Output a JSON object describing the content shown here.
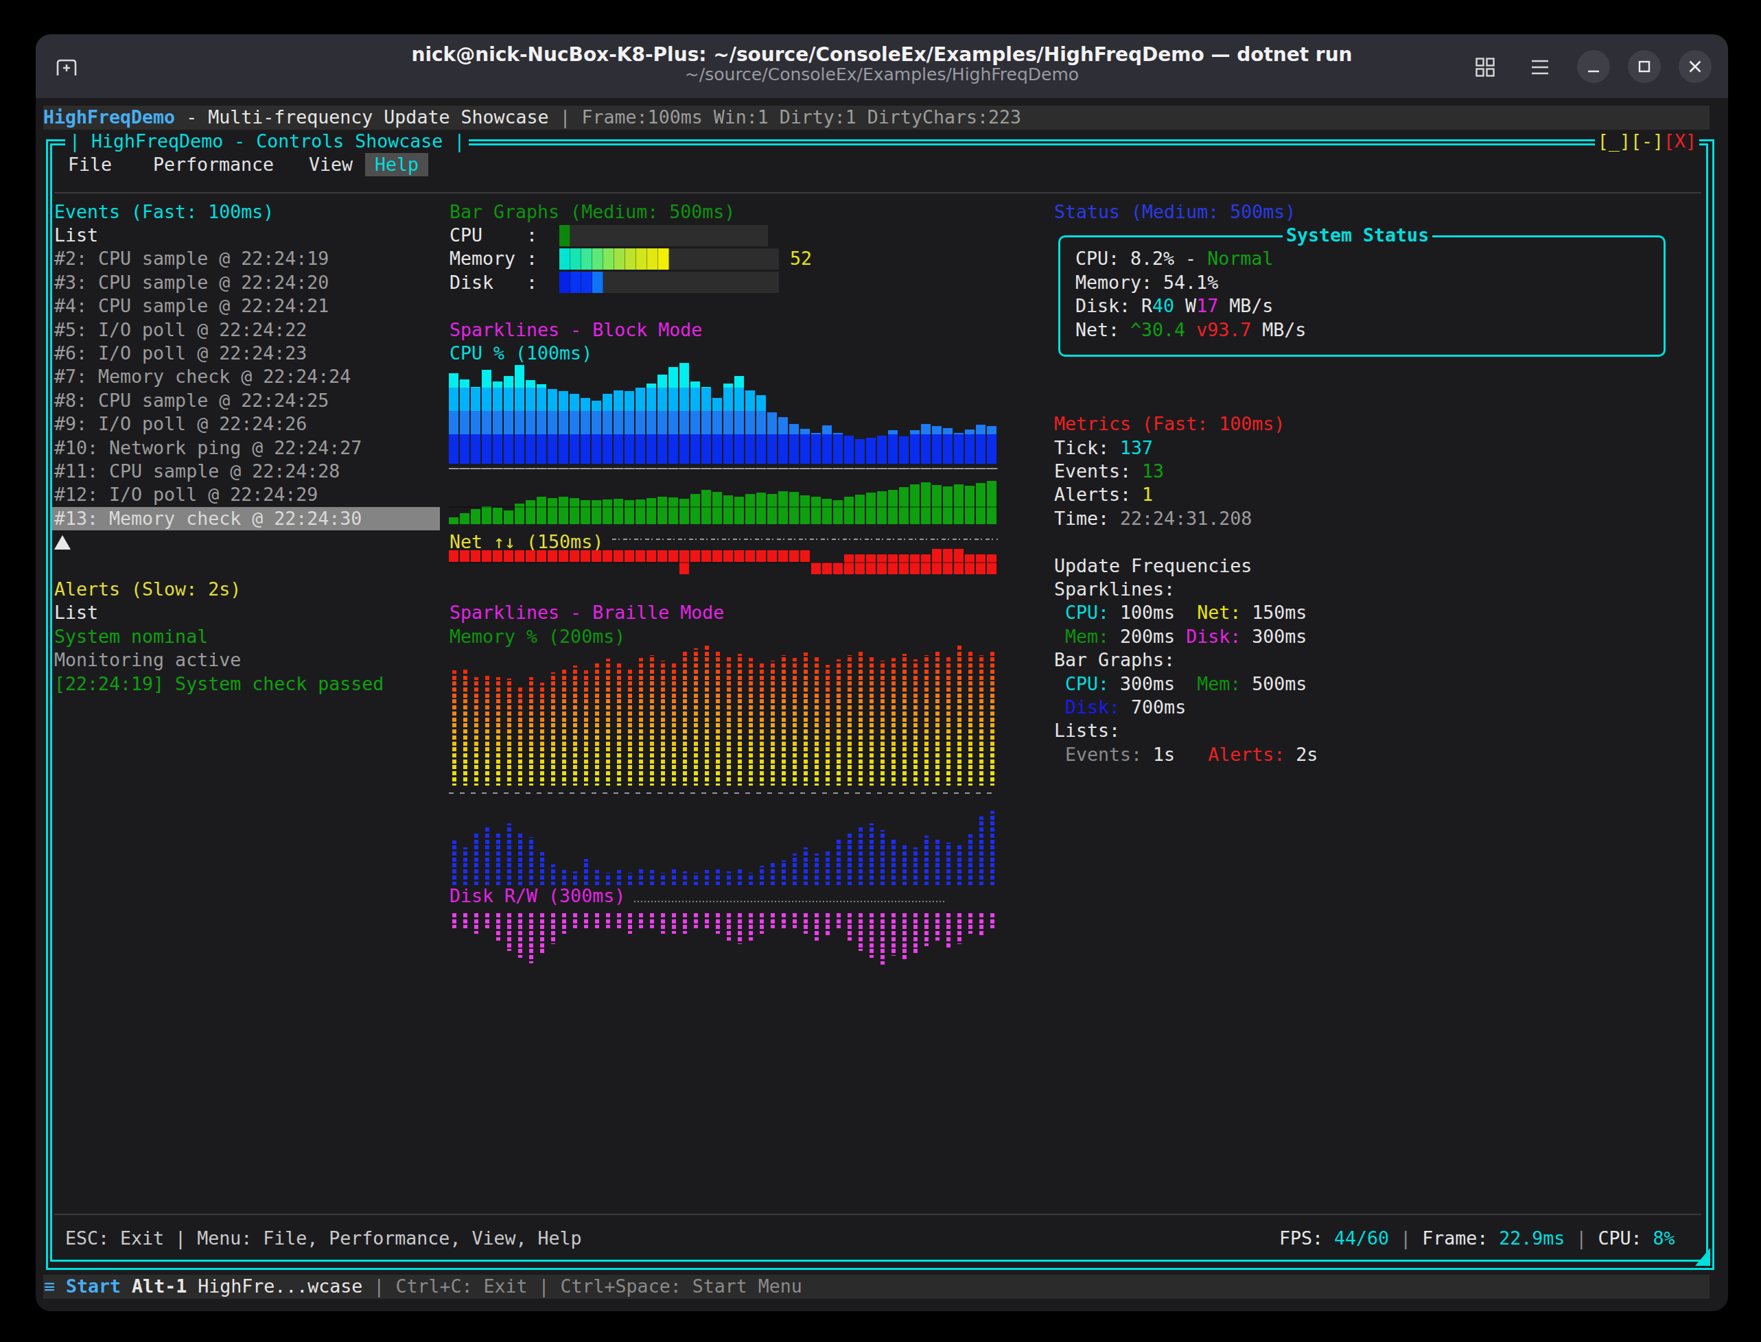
{
  "titlebar": {
    "title": "nick@nick-NucBox-K8-Plus: ~/source/ConsoleEx/Examples/HighFreqDemo — dotnet run",
    "subtitle": "~/source/ConsoleEx/Examples/HighFreqDemo",
    "icons": [
      "new-tab",
      "workspaces-grid",
      "menu",
      "minimize",
      "maximize",
      "close"
    ]
  },
  "app_status": {
    "segments": [
      {
        "t": "HighFreqDemo",
        "c": "skyblue",
        "b": true
      },
      {
        "t": " - Multi-frequency Update Showcase ",
        "c": "white"
      },
      {
        "t": "| Frame:100ms Win:1 Dirty:1 DirtyChars:223",
        "c": "grey"
      }
    ]
  },
  "tui_window": {
    "title": "| HighFreqDemo - Controls Showcase |",
    "buttons": [
      {
        "t": "[_]",
        "c": "yellow"
      },
      {
        "t": "[-]",
        "c": "yellow"
      },
      {
        "t": "[X]",
        "c": "red"
      }
    ]
  },
  "menu": {
    "items": [
      {
        "label": "File",
        "active": false
      },
      {
        "label": "Performance",
        "active": false
      },
      {
        "label": "View",
        "active": false
      },
      {
        "label": "Help",
        "active": true
      }
    ]
  },
  "events_panel": {
    "title": "Events (Fast: 100ms)",
    "list_label": "List",
    "items": [
      "#2: CPU sample @ 22:24:19",
      "#3: CPU sample @ 22:24:20",
      "#4: CPU sample @ 22:24:21",
      "#5: I/O poll @ 22:24:22",
      "#6: I/O poll @ 22:24:23",
      "#7: Memory check @ 22:24:24",
      "#8: CPU sample @ 22:24:25",
      "#9: I/O poll @ 22:24:26",
      "#10: Network ping @ 22:24:27",
      "#11: CPU sample @ 22:24:28",
      "#12: I/O poll @ 22:24:29",
      "#13: Memory check @ 22:24:30"
    ],
    "selected_index": 11,
    "scroll_indicator": "▲"
  },
  "alerts_panel": {
    "title": "Alerts (Slow: 2s)",
    "list_label": "List",
    "items": [
      {
        "t": "System nominal",
        "c": "green"
      },
      {
        "t": "Monitoring active",
        "c": "grey"
      },
      {
        "t": "[22:24:19] System check passed",
        "c": "green"
      }
    ]
  },
  "bar_graphs": {
    "title": "Bar Graphs (Medium: 500ms)",
    "cpu_label": "CPU    :",
    "memory_label": "Memory :",
    "disk_label": "Disk   :",
    "memory_value": "52"
  },
  "sparklines_block": {
    "title": "Sparklines - Block Mode",
    "cpu_label": "CPU % (100ms)",
    "net_label": "Net ↑↓ (150ms)"
  },
  "sparklines_braille": {
    "title": "Sparklines - Braille Mode",
    "memory_label": "Memory % (200ms)",
    "disk_label": "Disk R/W (300ms)"
  },
  "status_panel": {
    "title": "Status (Medium: 500ms)",
    "box_title": "System Status",
    "cpu": {
      "segments": [
        {
          "t": "CPU: 8.2% - ",
          "c": "white"
        },
        {
          "t": "Normal",
          "c": "green"
        }
      ]
    },
    "memory": {
      "segments": [
        {
          "t": "Memory: 54.1%",
          "c": "white"
        }
      ]
    },
    "disk": {
      "segments": [
        {
          "t": "Disk: R",
          "c": "white"
        },
        {
          "t": "40",
          "c": "cyan"
        },
        {
          "t": " W",
          "c": "white"
        },
        {
          "t": "17",
          "c": "magenta"
        },
        {
          "t": " MB/s",
          "c": "white"
        }
      ]
    },
    "net": {
      "segments": [
        {
          "t": "Net: ",
          "c": "white"
        },
        {
          "t": "^30.4",
          "c": "green"
        },
        {
          "t": " ",
          "c": "white"
        },
        {
          "t": "v93.7",
          "c": "red"
        },
        {
          "t": " MB/s",
          "c": "white"
        }
      ]
    }
  },
  "metrics_panel": {
    "title": "Metrics (Fast: 100ms)",
    "tick": {
      "segments": [
        {
          "t": "Tick: ",
          "c": "white"
        },
        {
          "t": "137",
          "c": "cyan"
        }
      ]
    },
    "events": {
      "segments": [
        {
          "t": "Events: ",
          "c": "white"
        },
        {
          "t": "13",
          "c": "green"
        }
      ]
    },
    "alerts": {
      "segments": [
        {
          "t": "Alerts: ",
          "c": "white"
        },
        {
          "t": "1",
          "c": "vyellow"
        }
      ]
    },
    "time": {
      "segments": [
        {
          "t": "Time: ",
          "c": "white"
        },
        {
          "t": "22:24:31.208",
          "c": "grey"
        }
      ]
    }
  },
  "update_frequencies": {
    "heading": "Update Frequencies",
    "sparklines_heading": "Sparklines:",
    "sparklines_row1": {
      "segments": [
        {
          "t": " ",
          "c": "white"
        },
        {
          "t": "CPU:",
          "c": "cyan"
        },
        {
          "t": " 100ms  ",
          "c": "white"
        },
        {
          "t": "Net:",
          "c": "vyellow"
        },
        {
          "t": " 150ms",
          "c": "white"
        }
      ]
    },
    "sparklines_row2": {
      "segments": [
        {
          "t": " ",
          "c": "white"
        },
        {
          "t": "Mem:",
          "c": "dgreen"
        },
        {
          "t": " 200ms ",
          "c": "white"
        },
        {
          "t": "Disk:",
          "c": "magenta"
        },
        {
          "t": " 300ms",
          "c": "white"
        }
      ]
    },
    "bars_heading": "Bar Graphs:",
    "bars_row1": {
      "segments": [
        {
          "t": " ",
          "c": "white"
        },
        {
          "t": "CPU:",
          "c": "cyan"
        },
        {
          "t": " 300ms  ",
          "c": "white"
        },
        {
          "t": "Mem:",
          "c": "dgreen"
        },
        {
          "t": " 500ms",
          "c": "white"
        }
      ]
    },
    "bars_row2": {
      "segments": [
        {
          "t": " ",
          "c": "white"
        },
        {
          "t": "Disk:",
          "c": "pblue"
        },
        {
          "t": " 700ms",
          "c": "white"
        }
      ]
    },
    "lists_heading": "Lists:",
    "lists_row": {
      "segments": [
        {
          "t": " ",
          "c": "white"
        },
        {
          "t": "Events:",
          "c": "dim"
        },
        {
          "t": " 1s   ",
          "c": "white"
        },
        {
          "t": "Alerts:",
          "c": "red"
        },
        {
          "t": " 2s",
          "c": "white"
        }
      ]
    }
  },
  "status_bar": {
    "left": "ESC: Exit | Menu: File, Performance, View, Help",
    "right": {
      "segments": [
        {
          "t": "FPS: ",
          "c": "white"
        },
        {
          "t": "44/60",
          "c": "cyan"
        },
        {
          "t": " | ",
          "c": "dim"
        },
        {
          "t": "Frame: ",
          "c": "white"
        },
        {
          "t": "22.9ms",
          "c": "cyan"
        },
        {
          "t": " | ",
          "c": "dim"
        },
        {
          "t": "CPU: ",
          "c": "white"
        },
        {
          "t": "8%",
          "c": "cyan"
        }
      ]
    }
  },
  "taskbar": {
    "segments": [
      {
        "t": "≡ ",
        "c": "skyblue"
      },
      {
        "t": "Start",
        "c": "skyblue",
        "b": true
      },
      {
        "t": " ",
        "c": "white"
      },
      {
        "t": "Alt-1",
        "c": "white",
        "b": true
      },
      {
        "t": " HighFre...wcase ",
        "c": "white"
      },
      {
        "t": "| Ctrl+C: Exit | Ctrl+Space: Start Menu",
        "c": "dim"
      }
    ]
  },
  "colors": {
    "terminal_bg": "#1B1B1E",
    "titlebar_bg": "#2E2E36",
    "status_row_bg": "#2D2D2D",
    "taskbar_bg": "#2B2B2B",
    "border_cyan": "#00DEDE",
    "accent_skyblue": "#47AEF2",
    "yellow": "#E2DE38",
    "green": "#0FA00F",
    "magenta": "#E424E4",
    "red": "#F02020",
    "blue": "#2A3AE8",
    "selected_row_bg": "#848484"
  },
  "chart_data": [
    {
      "id": "bar_cpu",
      "type": "bar",
      "title": "CPU",
      "track_cells": 19,
      "cells": [
        "#0C870C"
      ]
    },
    {
      "id": "bar_memory",
      "type": "bar",
      "title": "Memory",
      "value": 52,
      "track_cells": 20,
      "cells": [
        "#00E5D2",
        "#16E5B2",
        "#3BE896",
        "#5EE878",
        "#83E858",
        "#A3E241",
        "#BEE32C",
        "#D2E61C",
        "#E2E812",
        "#F2F004"
      ]
    },
    {
      "id": "bar_disk",
      "type": "bar",
      "title": "Disk",
      "track_cells": 20,
      "cells": [
        "#0522E8",
        "#0734F2",
        "#0734F2",
        "#0F74F6"
      ]
    },
    {
      "id": "cpu_sparkline",
      "type": "area",
      "title": "CPU % (100ms)",
      "max": 147,
      "band_colors": [
        "#00EEF0",
        "#00B2F8",
        "#1E7CF2",
        "#0A2CEE"
      ],
      "band_stops": [
        147,
        111,
        77,
        43
      ],
      "values": [
        132,
        123,
        112,
        137,
        120,
        128,
        144,
        122,
        116,
        109,
        106,
        102,
        96,
        92,
        102,
        107,
        106,
        111,
        117,
        130,
        141,
        147,
        120,
        112,
        96,
        117,
        128,
        107,
        100,
        75,
        68,
        58,
        51,
        45,
        56,
        45,
        41,
        36,
        38,
        41,
        49,
        40,
        49,
        58,
        55,
        52,
        45,
        50,
        57,
        55
      ]
    },
    {
      "id": "memory_sparkline",
      "type": "area",
      "title": "Memory",
      "max": 64,
      "color": "#0EA00E",
      "values": [
        10,
        16,
        22,
        26,
        24,
        20,
        30,
        35,
        40,
        38,
        40,
        38,
        35,
        35,
        36,
        37,
        35,
        36,
        38,
        40,
        39,
        37,
        44,
        50,
        47,
        42,
        40,
        44,
        46,
        44,
        48,
        47,
        42,
        40,
        37,
        35,
        40,
        43,
        46,
        48,
        50,
        54,
        58,
        61,
        57,
        55,
        58,
        56,
        60,
        63
      ]
    },
    {
      "id": "net_sparkline",
      "type": "area",
      "title": "Net ↑↓ (150ms)",
      "color": "#F01414",
      "values": [
        [
          2,
          17
        ],
        [
          2,
          17
        ],
        [
          2,
          17
        ],
        [
          2,
          17
        ],
        [
          2,
          17
        ],
        [
          2,
          17
        ],
        [
          2,
          17
        ],
        [
          2,
          17
        ],
        [
          2,
          17
        ],
        [
          2,
          17
        ],
        [
          2,
          17
        ],
        [
          2,
          17
        ],
        [
          2,
          17
        ],
        [
          2,
          17
        ],
        [
          2,
          17
        ],
        [
          2,
          17
        ],
        [
          2,
          17
        ],
        [
          2,
          17
        ],
        [
          2,
          17
        ],
        [
          2,
          17
        ],
        [
          2,
          17
        ],
        [
          2,
          35
        ],
        [
          2,
          17
        ],
        [
          2,
          17
        ],
        [
          2,
          17
        ],
        [
          2,
          17
        ],
        [
          2,
          17
        ],
        [
          2,
          17
        ],
        [
          2,
          17
        ],
        [
          2,
          17
        ],
        [
          2,
          17
        ],
        [
          2,
          17
        ],
        [
          2,
          17
        ],
        [
          20,
          17
        ],
        [
          20,
          17
        ],
        [
          20,
          17
        ],
        [
          8,
          29
        ],
        [
          8,
          29
        ],
        [
          8,
          29
        ],
        [
          8,
          29
        ],
        [
          8,
          29
        ],
        [
          8,
          29
        ],
        [
          8,
          29
        ],
        [
          8,
          29
        ],
        [
          0,
          37
        ],
        [
          0,
          37
        ],
        [
          0,
          37
        ],
        [
          8,
          29
        ],
        [
          8,
          29
        ],
        [
          8,
          29
        ]
      ]
    },
    {
      "id": "braille_memory",
      "type": "area",
      "title": "Memory % (200ms)",
      "max": 204,
      "gradient": [
        "#F5270A",
        "#F5480C",
        "#F57D12",
        "#F2A90C",
        "#EDD506",
        "#E8E405"
      ],
      "values": [
        168,
        170,
        158,
        160,
        158,
        156,
        146,
        158,
        150,
        165,
        172,
        175,
        168,
        180,
        185,
        178,
        172,
        186,
        190,
        182,
        178,
        195,
        200,
        204,
        196,
        188,
        192,
        186,
        178,
        182,
        190,
        186,
        194,
        188,
        176,
        184,
        190,
        196,
        188,
        182,
        186,
        192,
        184,
        190,
        198,
        188,
        204,
        196,
        190,
        196
      ]
    },
    {
      "id": "braille_secondary",
      "type": "area",
      "title": "",
      "max": 110,
      "color": "#1C2CF6",
      "values": [
        65,
        55,
        75,
        86,
        75,
        90,
        76,
        70,
        48,
        30,
        22,
        20,
        38,
        22,
        18,
        22,
        18,
        26,
        22,
        18,
        24,
        20,
        18,
        22,
        26,
        20,
        24,
        18,
        28,
        32,
        36,
        46,
        55,
        46,
        52,
        66,
        75,
        86,
        90,
        80,
        68,
        60,
        55,
        72,
        66,
        62,
        58,
        74,
        100,
        108
      ]
    },
    {
      "id": "braille_disk",
      "type": "area",
      "title": "Disk R/W (300ms)",
      "max": 80,
      "color": "#EE3CEE",
      "direction": "down",
      "values": [
        22,
        22,
        30,
        22,
        40,
        55,
        65,
        73,
        60,
        45,
        30,
        22,
        22,
        22,
        22,
        22,
        30,
        22,
        22,
        30,
        30,
        30,
        22,
        22,
        30,
        40,
        45,
        40,
        30,
        22,
        22,
        22,
        30,
        40,
        35,
        22,
        40,
        55,
        65,
        75,
        62,
        70,
        58,
        48,
        40,
        52,
        45,
        30,
        35,
        22
      ]
    }
  ]
}
